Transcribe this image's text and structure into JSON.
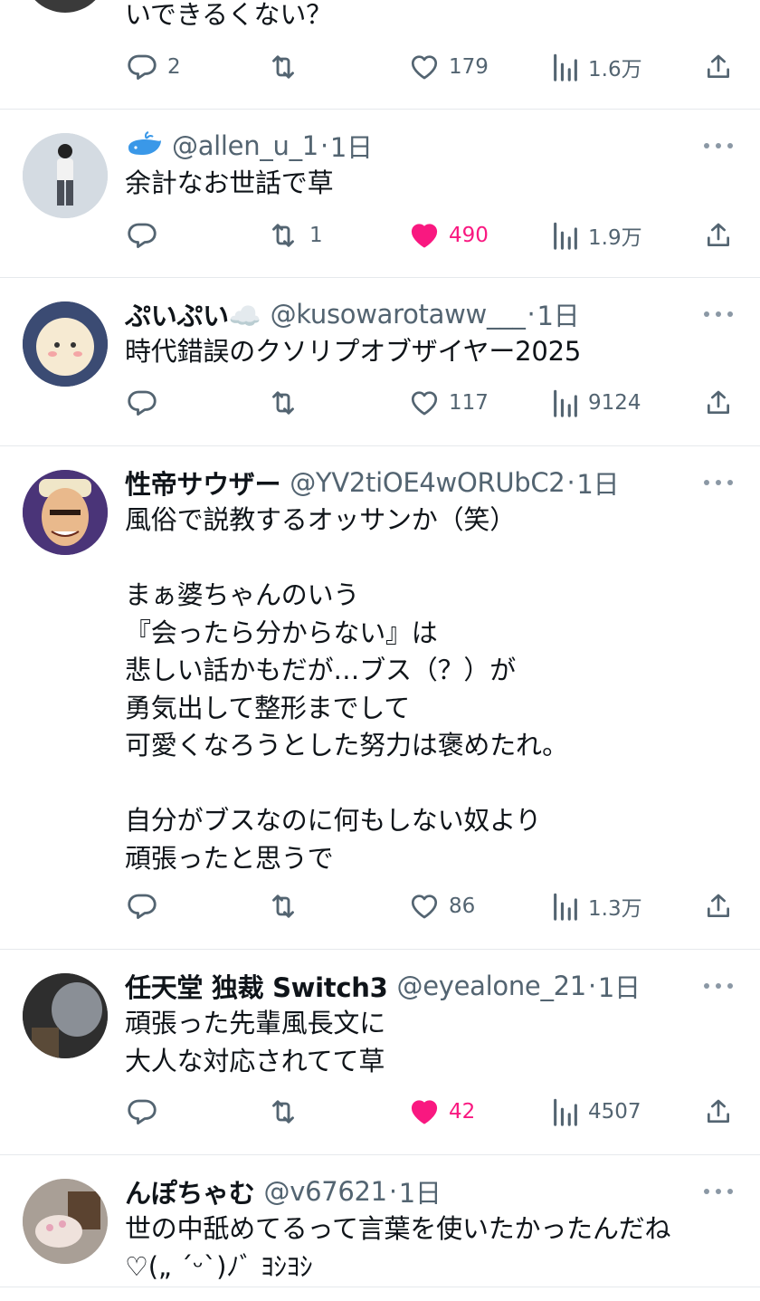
{
  "partial_post": {
    "text": "いできるくない？",
    "replies": "2",
    "likes": "179",
    "views": "1.6万"
  },
  "posts": [
    {
      "name": "",
      "handle": "@allen_u_1",
      "time": "1日",
      "text": "余計なお世話で草",
      "replies": "",
      "retweets": "1",
      "likes": "490",
      "liked": true,
      "views": "1.9万"
    },
    {
      "name": "ぷいぷい☁️",
      "handle": "@kusowarotaww___",
      "time": "1日",
      "text": "時代錯誤のクソリプオブザイヤー2025",
      "replies": "",
      "retweets": "",
      "likes": "117",
      "liked": false,
      "views": "9124"
    },
    {
      "name": "性帝サウザー",
      "handle": "@YV2tiOE4wORUbC2",
      "time": "1日",
      "text": "風俗で説教するオッサンか（笑）\n\nまぁ婆ちゃんのいう\n『会ったら分からない』は\n悲しい話かもだが…ブス（？）が\n勇気出して整形までして\n可愛くなろうとした努力は褒めたれ。\n\n自分がブスなのに何もしない奴より\n頑張ったと思うで",
      "replies": "",
      "retweets": "",
      "likes": "86",
      "liked": false,
      "views": "1.3万"
    },
    {
      "name": "任天堂 独裁 Switch3",
      "handle": "@eyealone_21",
      "time": "1日",
      "text": "頑張った先輩風長文に\n大人な対応されてて草",
      "replies": "",
      "retweets": "",
      "likes": "42",
      "liked": true,
      "views": "4507"
    },
    {
      "name": "んぽちゃむ",
      "handle": "@v67621",
      "time": "1日",
      "text": "世の中舐めてるって言葉を使いたかったんだね\n♡(„ ´ᵕ`)ﾉﾞ ﾖｼﾖｼ",
      "replies": "",
      "retweets": "",
      "likes": "",
      "liked": false,
      "views": ""
    }
  ],
  "separator": "·",
  "icons": {
    "reply": "reply-icon",
    "retweet": "retweet-icon",
    "like": "heart-icon",
    "views": "views-icon",
    "share": "share-icon",
    "more": "more-icon",
    "badge": "whale-icon"
  },
  "colors": {
    "text": "#0f1419",
    "secondary": "#536471",
    "like_active": "#f91880",
    "divider": "#e6e9ec"
  }
}
